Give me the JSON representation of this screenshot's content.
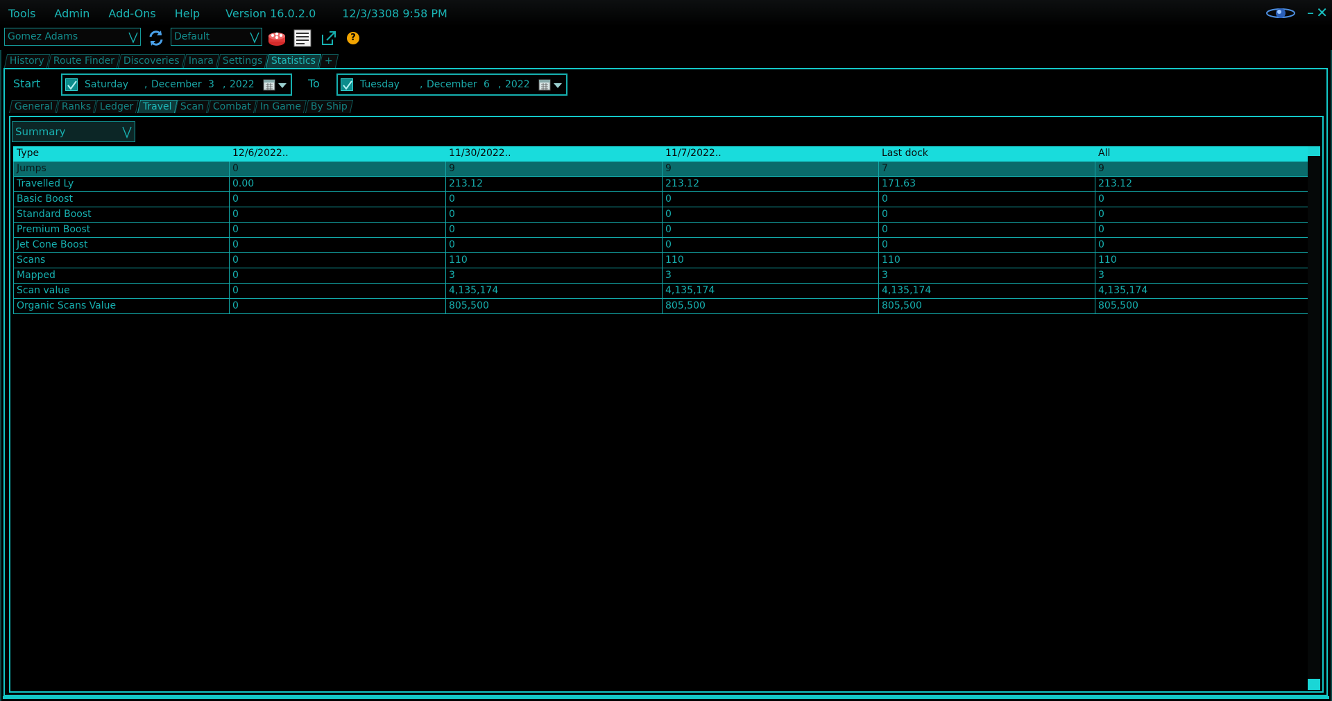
{
  "menu": {
    "items": [
      "Tools",
      "Admin",
      "Add-Ons",
      "Help"
    ],
    "version": "Version 16.0.2.0",
    "clock": "12/3/3308 9:58 PM"
  },
  "window": {
    "minimize": "–",
    "close": "✕"
  },
  "toolbar": {
    "commander": "Gomez Adams",
    "profile": "Default",
    "icons": [
      "refresh-icon",
      "cake-icon",
      "notes-icon",
      "popout-icon",
      "help-icon"
    ],
    "help_glyph": "?"
  },
  "main_tabs": [
    "History",
    "Route Finder",
    "Discoveries",
    "Inara",
    "Settings",
    "Statistics",
    "+"
  ],
  "main_tab_active": "Statistics",
  "date_range": {
    "start_label": "Start",
    "to_label": "To",
    "start": {
      "weekday": "Saturday",
      "month": "December",
      "day": "3",
      "year": "2022",
      "checked": true
    },
    "end": {
      "weekday": "Tuesday",
      "month": "December",
      "day": "6",
      "year": "2022",
      "checked": true
    }
  },
  "sub_tabs": [
    "General",
    "Ranks",
    "Ledger",
    "Travel",
    "Scan",
    "Combat",
    "In Game",
    "By Ship"
  ],
  "sub_tab_active": "Travel",
  "view_select": "Summary",
  "table": {
    "columns": [
      "Type",
      "12/6/2022..",
      "11/30/2022..",
      "11/7/2022..",
      "Last dock",
      "All"
    ],
    "rows": [
      [
        "Jumps",
        "0",
        "9",
        "9",
        "7",
        "9"
      ],
      [
        "Travelled Ly",
        "0.00",
        "213.12",
        "213.12",
        "171.63",
        "213.12"
      ],
      [
        "Basic Boost",
        "0",
        "0",
        "0",
        "0",
        "0"
      ],
      [
        "Standard Boost",
        "0",
        "0",
        "0",
        "0",
        "0"
      ],
      [
        "Premium Boost",
        "0",
        "0",
        "0",
        "0",
        "0"
      ],
      [
        "Jet Cone Boost",
        "0",
        "0",
        "0",
        "0",
        "0"
      ],
      [
        "Scans",
        "0",
        "110",
        "110",
        "110",
        "110"
      ],
      [
        "Mapped",
        "0",
        "3",
        "3",
        "3",
        "3"
      ],
      [
        "Scan value",
        "0",
        "4,135,174",
        "4,135,174",
        "4,135,174",
        "4,135,174"
      ],
      [
        "Organic Scans Value",
        "0",
        "805,500",
        "805,500",
        "805,500",
        "805,500"
      ]
    ],
    "selected_row": 0
  },
  "colors": {
    "accent": "#13c8c8",
    "text": "#17b4b4",
    "header_bg": "#19dcdc",
    "background": "#000000"
  }
}
